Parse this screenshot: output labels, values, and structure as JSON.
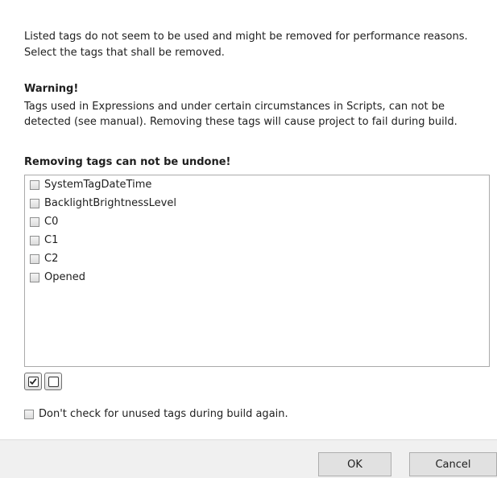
{
  "intro_text": "Listed tags do not seem to be used and might be removed for performance reasons. Select the tags that shall be removed.",
  "warning": {
    "title": "Warning!",
    "text": "Tags used in Expressions and under certain circumstances in Scripts, can not be detected (see manual). Removing these tags will cause project to fail during build.",
    "final": "Removing tags can not be undone!"
  },
  "tags": [
    {
      "label": "SystemTagDateTime",
      "checked": false
    },
    {
      "label": "BacklightBrightnessLevel",
      "checked": false
    },
    {
      "label": "C0",
      "checked": false
    },
    {
      "label": "C1",
      "checked": false
    },
    {
      "label": "C2",
      "checked": false
    },
    {
      "label": "Opened",
      "checked": false
    }
  ],
  "select_all_icon": "checked-box-icon",
  "deselect_all_icon": "empty-box-icon",
  "dont_check": {
    "label": "Don't check for unused tags during build again.",
    "checked": false
  },
  "buttons": {
    "ok": "OK",
    "cancel": "Cancel"
  }
}
